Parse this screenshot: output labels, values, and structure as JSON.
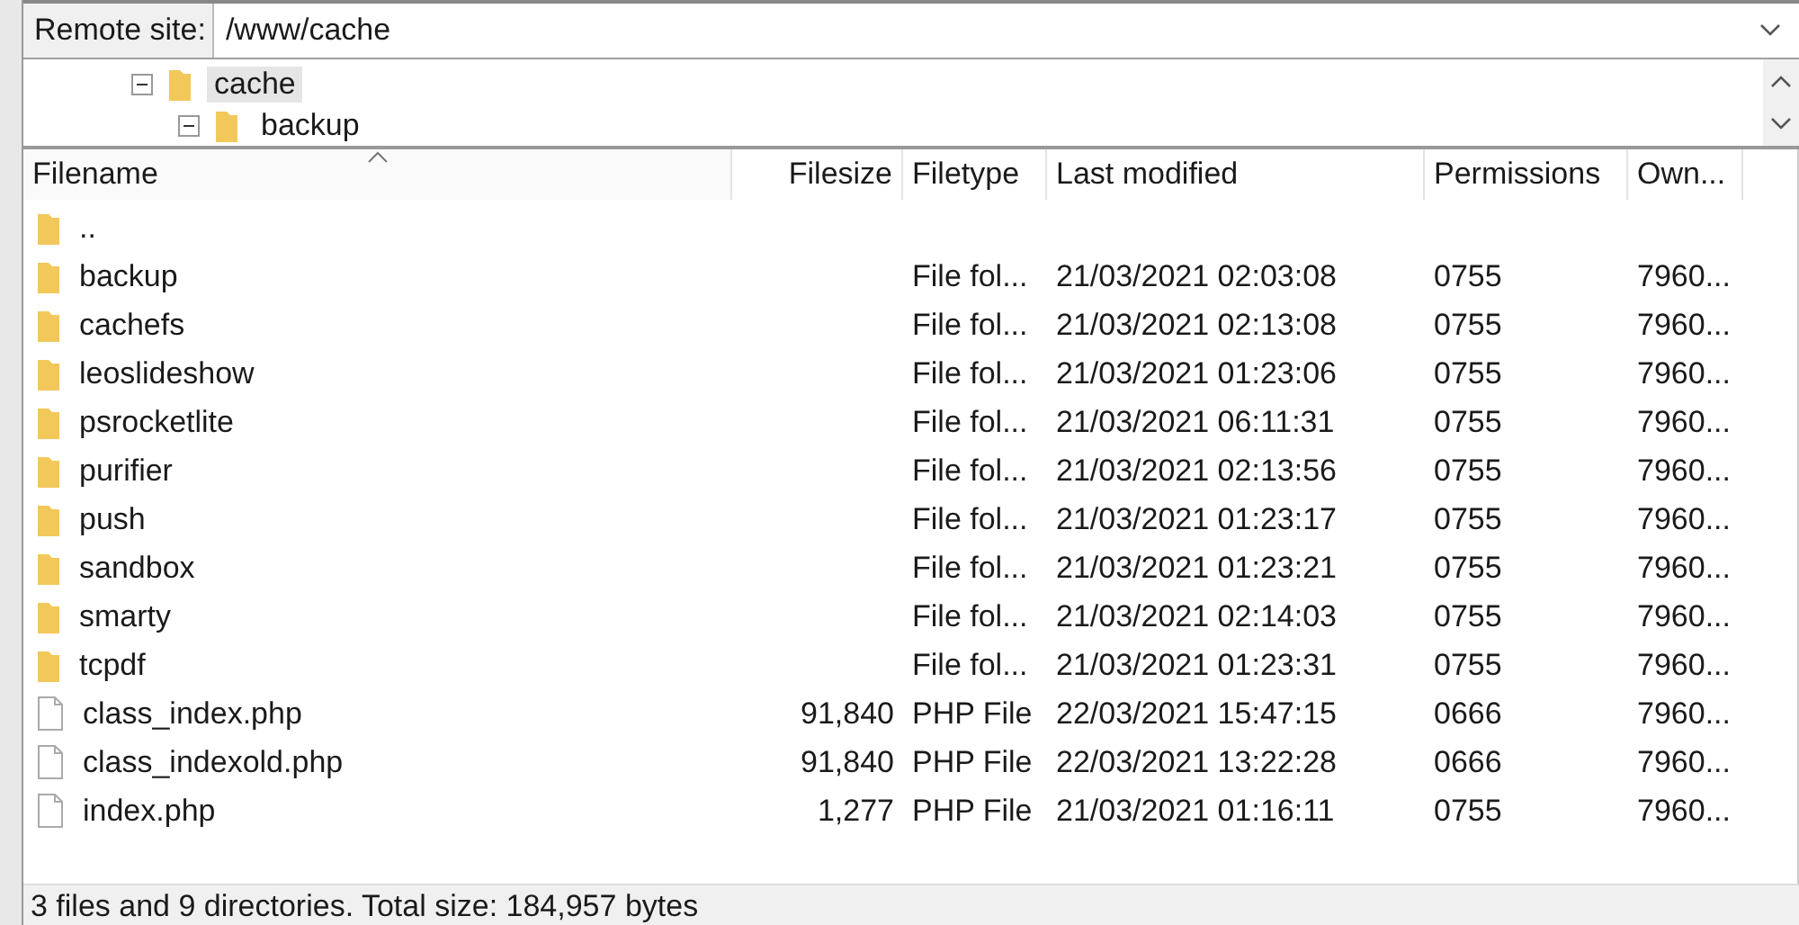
{
  "remote_site": {
    "label": "Remote site:",
    "path": "/www/cache"
  },
  "tree": [
    {
      "label": "cache",
      "selected": true,
      "expanded": true,
      "children": [
        {
          "label": "backup",
          "selected": false,
          "expanded": true
        }
      ]
    }
  ],
  "table": {
    "columns": [
      {
        "label": "Filename",
        "sorted": true
      },
      {
        "label": "Filesize",
        "sorted": false
      },
      {
        "label": "Filetype",
        "sorted": false
      },
      {
        "label": "Last modified",
        "sorted": false
      },
      {
        "label": "Permissions",
        "sorted": false
      },
      {
        "label": "Own...",
        "sorted": false
      }
    ],
    "rows": [
      {
        "kind": "folder",
        "cells": [
          "..",
          "",
          "",
          "",
          "",
          ""
        ]
      },
      {
        "kind": "folder",
        "cells": [
          "backup",
          "",
          "File fol...",
          "21/03/2021 02:03:08",
          "0755",
          "7960..."
        ]
      },
      {
        "kind": "folder",
        "cells": [
          "cachefs",
          "",
          "File fol...",
          "21/03/2021 02:13:08",
          "0755",
          "7960..."
        ]
      },
      {
        "kind": "folder",
        "cells": [
          "leoslideshow",
          "",
          "File fol...",
          "21/03/2021 01:23:06",
          "0755",
          "7960..."
        ]
      },
      {
        "kind": "folder",
        "cells": [
          "psrocketlite",
          "",
          "File fol...",
          "21/03/2021 06:11:31",
          "0755",
          "7960..."
        ]
      },
      {
        "kind": "folder",
        "cells": [
          "purifier",
          "",
          "File fol...",
          "21/03/2021 02:13:56",
          "0755",
          "7960..."
        ]
      },
      {
        "kind": "folder",
        "cells": [
          "push",
          "",
          "File fol...",
          "21/03/2021 01:23:17",
          "0755",
          "7960..."
        ]
      },
      {
        "kind": "folder",
        "cells": [
          "sandbox",
          "",
          "File fol...",
          "21/03/2021 01:23:21",
          "0755",
          "7960..."
        ]
      },
      {
        "kind": "folder",
        "cells": [
          "smarty",
          "",
          "File fol...",
          "21/03/2021 02:14:03",
          "0755",
          "7960..."
        ]
      },
      {
        "kind": "folder",
        "cells": [
          "tcpdf",
          "",
          "File fol...",
          "21/03/2021 01:23:31",
          "0755",
          "7960..."
        ]
      },
      {
        "kind": "file",
        "cells": [
          "class_index.php",
          "91,840",
          "PHP File",
          "22/03/2021 15:47:15",
          "0666",
          "7960..."
        ]
      },
      {
        "kind": "file",
        "cells": [
          "class_indexold.php",
          "91,840",
          "PHP File",
          "22/03/2021 13:22:28",
          "0666",
          "7960..."
        ]
      },
      {
        "kind": "file",
        "cells": [
          "index.php",
          "1,277",
          "PHP File",
          "21/03/2021 01:16:11",
          "0755",
          "7960..."
        ]
      }
    ]
  },
  "status_bar": "3 files and 9 directories. Total size: 184,957 bytes"
}
